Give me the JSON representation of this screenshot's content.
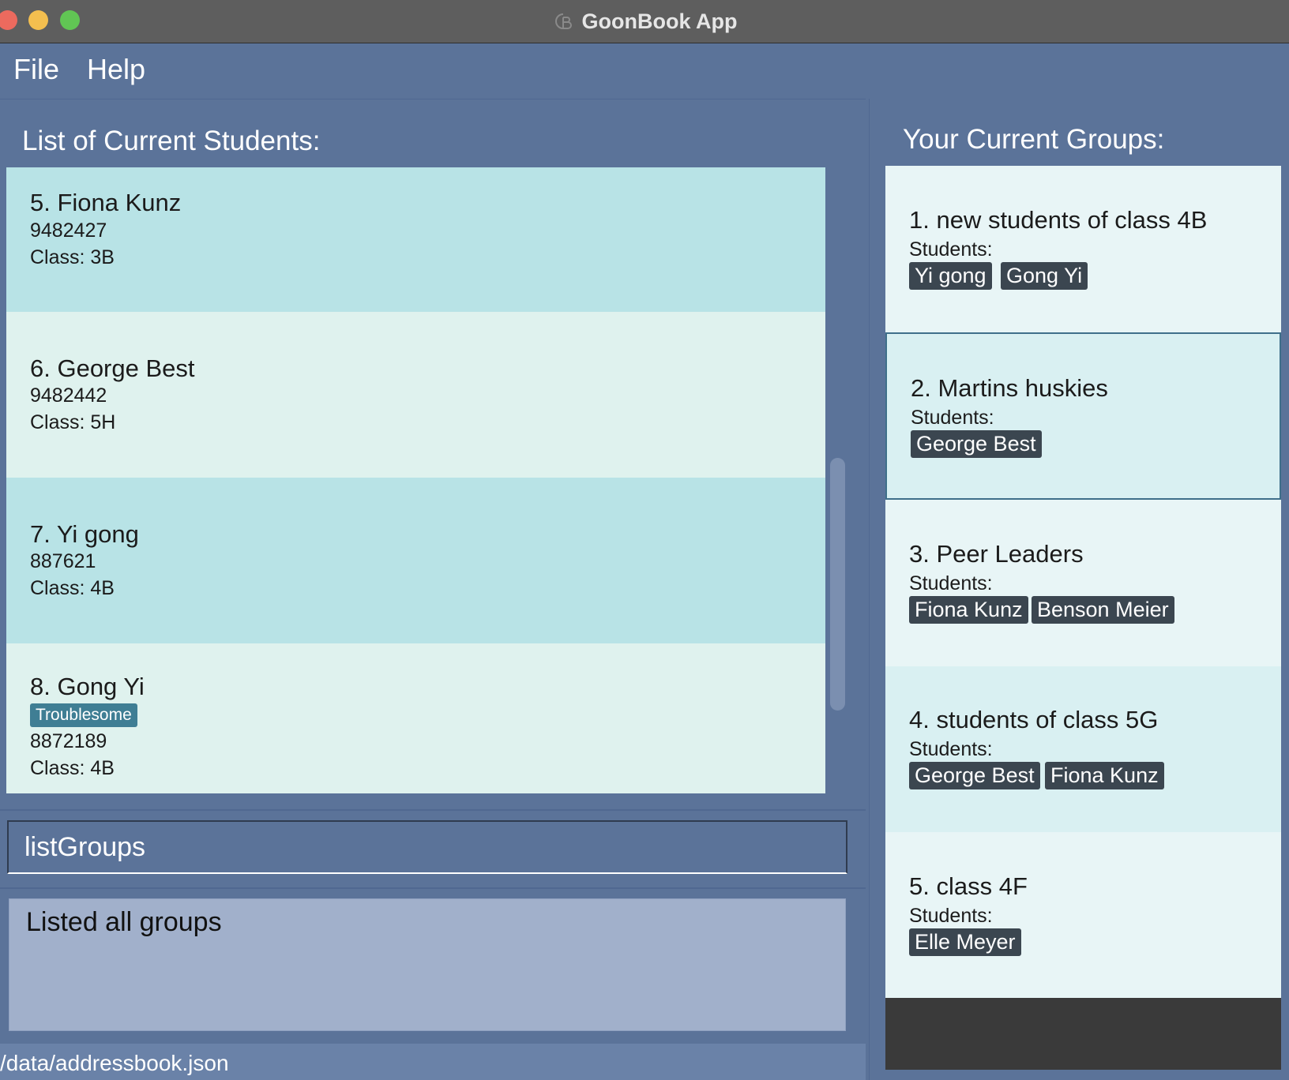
{
  "window": {
    "title": "GoonBook App"
  },
  "menu": {
    "file": "File",
    "help": "Help"
  },
  "students_panel": {
    "title": "List of Current Students:",
    "students": [
      {
        "name": "5. Fiona Kunz",
        "phone": "9482427",
        "class": "Class: 3B",
        "tags": []
      },
      {
        "name": "6. George Best",
        "phone": "9482442",
        "class": "Class: 5H",
        "tags": []
      },
      {
        "name": "7. Yi gong",
        "phone": "887621",
        "class": "Class: 4B",
        "tags": []
      },
      {
        "name": "8. Gong Yi",
        "phone": "8872189",
        "class": "Class: 4B",
        "tags": [
          "Troublesome"
        ]
      }
    ]
  },
  "command": {
    "value": "listGroups"
  },
  "result": {
    "text": "Listed all groups"
  },
  "status": {
    "path": "/data/addressbook.json"
  },
  "groups_panel": {
    "title": "Your Current Groups:",
    "students_label": "Students:",
    "groups": [
      {
        "name": "1. new students of class 4B",
        "members": [
          "Yi gong",
          "Gong Yi"
        ]
      },
      {
        "name": "2. Martins huskies",
        "members": [
          "George Best"
        ],
        "selected": true
      },
      {
        "name": "3. Peer Leaders",
        "members": [
          "Fiona Kunz",
          "Benson Meier"
        ]
      },
      {
        "name": "4. students of class 5G",
        "members": [
          "George Best",
          "Fiona Kunz"
        ]
      },
      {
        "name": "5. class 4F",
        "members": [
          "Elle Meyer"
        ]
      }
    ]
  },
  "colors": {
    "background": "#5b7399",
    "card_odd": "#b8e3e6",
    "card_even": "#dff2ee",
    "tag": "#3f7e94",
    "chip": "#3b4650"
  }
}
